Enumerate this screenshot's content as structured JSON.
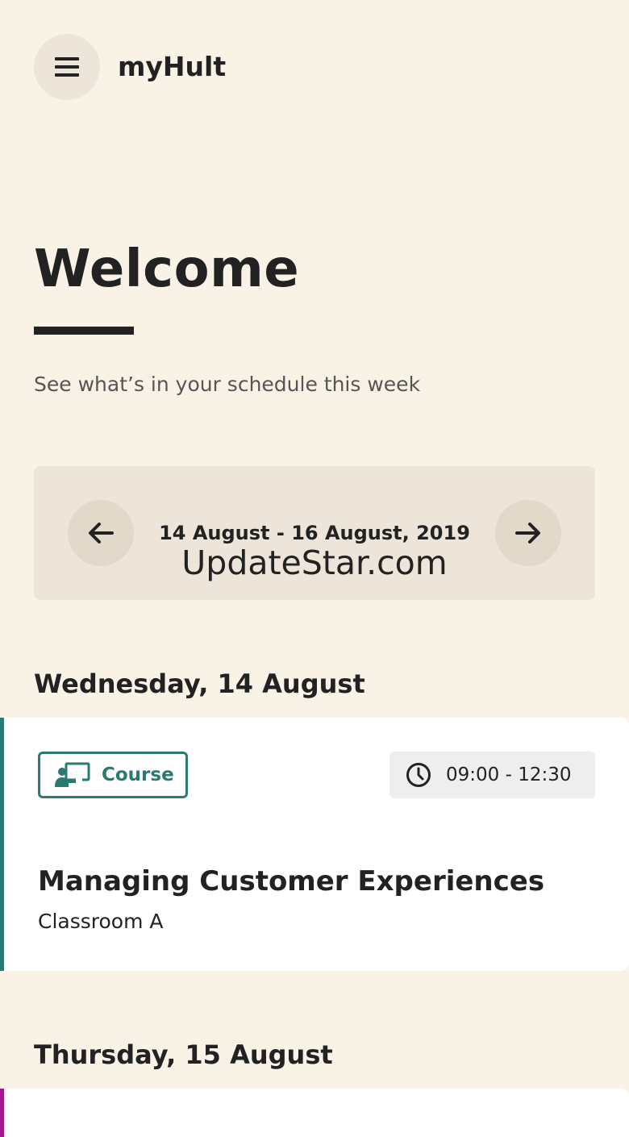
{
  "header": {
    "menu_icon": "hamburger-menu-icon",
    "app_title": "myHult"
  },
  "welcome": {
    "title": "Welcome",
    "subtitle": "See what’s in your schedule this week"
  },
  "week_nav": {
    "prev_icon": "arrow-left-icon",
    "next_icon": "arrow-right-icon",
    "date_range": "14 August - 16 August, 2019"
  },
  "watermark": "UpdateStar.com",
  "days": [
    {
      "heading": "Wednesday, 14 August",
      "events": [
        {
          "type": "Course",
          "type_icon": "classroom-teacher-icon",
          "time_icon": "clock-icon",
          "time": "09:00 - 12:30",
          "title": "Managing Customer Experiences",
          "location": "Classroom A",
          "accent_color": "#2a7a71"
        }
      ]
    },
    {
      "heading": "Thursday, 15 August",
      "events": [
        {
          "accent_color": "#a3198b"
        }
      ]
    }
  ],
  "colors": {
    "background": "#f9f2e7",
    "panel": "#ede5d9",
    "course_accent": "#2a7a71",
    "second_event_accent": "#a3198b",
    "text": "#222222"
  }
}
